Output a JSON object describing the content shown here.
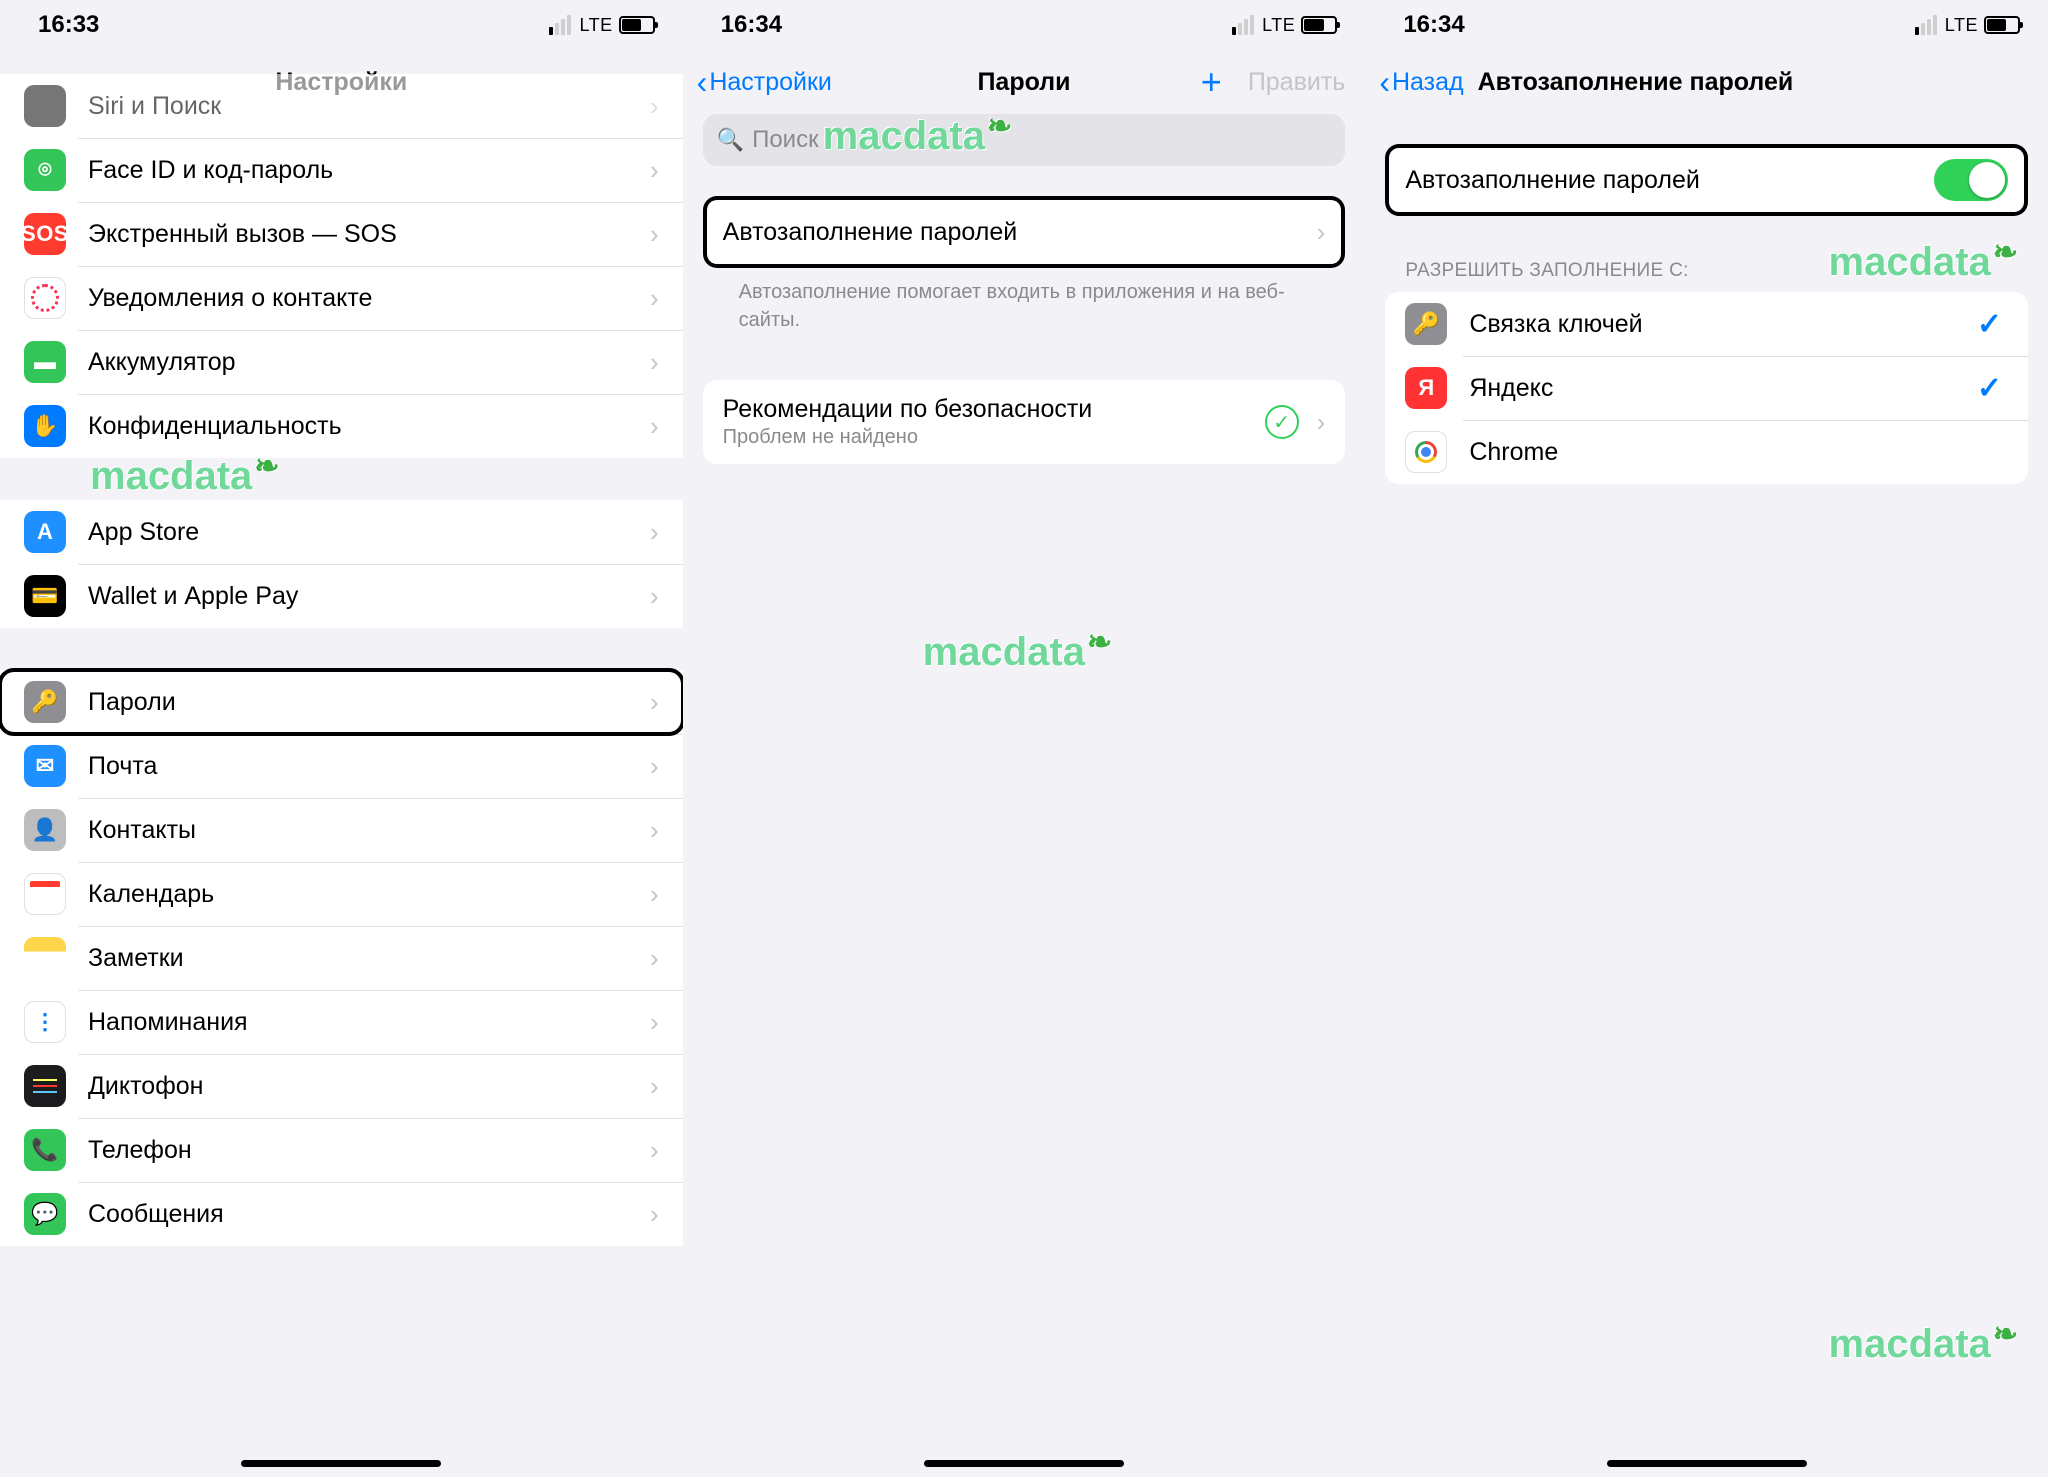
{
  "watermark": "macdata",
  "status": {
    "lte": "LTE"
  },
  "screen1": {
    "time": "16:33",
    "title": "Настройки",
    "rows_a": [
      {
        "id": "siri",
        "label": "Siri и Поиск",
        "icon": "ic-siri",
        "glyph": ""
      },
      {
        "id": "faceid",
        "label": "Face ID и код-пароль",
        "icon": "ic-faceid",
        "glyph": "⌾"
      },
      {
        "id": "sos",
        "label": "Экстренный вызов — SOS",
        "icon": "ic-sos",
        "glyph": "SOS"
      },
      {
        "id": "exposure",
        "label": "Уведомления о контакте",
        "icon": "ic-expose",
        "glyph": ""
      },
      {
        "id": "battery",
        "label": "Аккумулятор",
        "icon": "ic-battery",
        "glyph": "▬"
      },
      {
        "id": "privacy",
        "label": "Конфиденциальность",
        "icon": "ic-privacy",
        "glyph": "✋"
      }
    ],
    "rows_b": [
      {
        "id": "appstore",
        "label": "App Store",
        "icon": "ic-appstore",
        "glyph": "A"
      },
      {
        "id": "wallet",
        "label": "Wallet и Apple Pay",
        "icon": "ic-wallet",
        "glyph": "💳"
      }
    ],
    "rows_c": [
      {
        "id": "passwords",
        "label": "Пароли",
        "icon": "ic-passwords",
        "glyph": "🔑",
        "highlight": true
      },
      {
        "id": "mail",
        "label": "Почта",
        "icon": "ic-mail",
        "glyph": "✉"
      },
      {
        "id": "contacts",
        "label": "Контакты",
        "icon": "ic-contacts",
        "glyph": "👤"
      },
      {
        "id": "calendar",
        "label": "Календарь",
        "icon": "ic-calendar",
        "glyph": ""
      },
      {
        "id": "notes",
        "label": "Заметки",
        "icon": "ic-notes",
        "glyph": ""
      },
      {
        "id": "reminders",
        "label": "Напоминания",
        "icon": "ic-reminders",
        "glyph": ""
      },
      {
        "id": "voicememos",
        "label": "Диктофон",
        "icon": "ic-voice",
        "glyph": ""
      },
      {
        "id": "phone",
        "label": "Телефон",
        "icon": "ic-phone",
        "glyph": "📞"
      },
      {
        "id": "messages",
        "label": "Сообщения",
        "icon": "ic-messages",
        "glyph": "💬"
      }
    ]
  },
  "screen2": {
    "time": "16:34",
    "back": "Настройки",
    "title": "Пароли",
    "edit": "Править",
    "search_placeholder": "Поиск",
    "autofill_label": "Автозаполнение паролей",
    "autofill_footer": "Автозаполнение помогает входить в приложения и на веб-сайты.",
    "security_title": "Рекомендации по безопасности",
    "security_sub": "Проблем не найдено"
  },
  "screen3": {
    "time": "16:34",
    "back": "Назад",
    "title": "Автозаполнение паролей",
    "toggle_label": "Автозаполнение паролей",
    "toggle_on": true,
    "section_label": "РАЗРЕШИТЬ ЗАПОЛНЕНИЕ С:",
    "providers": [
      {
        "id": "keychain",
        "label": "Связка ключей",
        "icon": "ic-keychain",
        "glyph": "🔑",
        "checked": true
      },
      {
        "id": "yandex",
        "label": "Яндекс",
        "icon": "ic-yandex",
        "glyph": "Я",
        "checked": true
      },
      {
        "id": "chrome",
        "label": "Chrome",
        "icon": "ic-chrome",
        "glyph": "",
        "checked": false
      }
    ]
  }
}
